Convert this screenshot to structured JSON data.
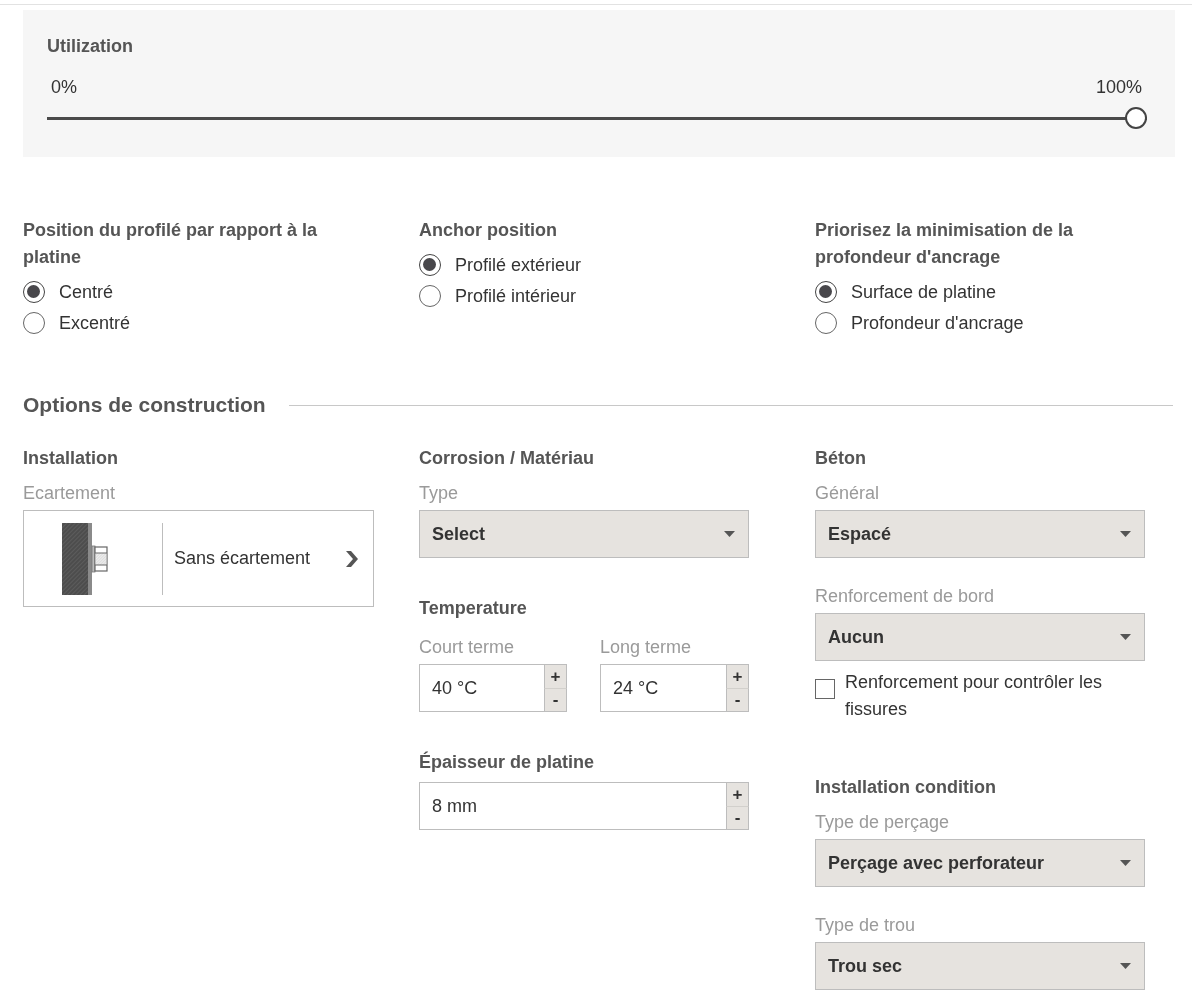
{
  "utilization": {
    "title": "Utilization",
    "min_label": "0%",
    "max_label": "100%",
    "level": 1
  },
  "radio_groups": [
    {
      "title": "Position du profilé par rapport à la platine",
      "options": [
        {
          "label": "Centré",
          "selected": true
        },
        {
          "label": "Excentré",
          "selected": false
        }
      ]
    },
    {
      "title": "Anchor position",
      "options": [
        {
          "label": "Profilé extérieur",
          "selected": true
        },
        {
          "label": "Profilé intérieur",
          "selected": false
        }
      ]
    },
    {
      "title": "Priorisez la minimisation de la profondeur d'ancrage",
      "options": [
        {
          "label": "Surface de platine",
          "selected": true
        },
        {
          "label": "Profondeur d'ancrage",
          "selected": false
        }
      ]
    }
  ],
  "construction": {
    "title": "Options de construction",
    "columns": [
      {
        "sections": [
          {
            "title": "Installation",
            "fields": [
              {
                "kind": "card",
                "label": "Ecartement",
                "value": "Sans écartement"
              }
            ]
          }
        ]
      },
      {
        "sections": [
          {
            "title": "Corrosion / Matériau",
            "fields": [
              {
                "kind": "select",
                "label": "Type",
                "value": "Select"
              }
            ]
          },
          {
            "title": "Temperature",
            "fields": [
              {
                "kind": "pair",
                "fields": [
                  {
                    "kind": "spinner",
                    "label": "Court terme",
                    "value": "40 °C",
                    "increment": "+",
                    "decrement": "-"
                  },
                  {
                    "kind": "spinner",
                    "label": "Long terme",
                    "value": "24 °C",
                    "increment": "+",
                    "decrement": "-"
                  }
                ]
              }
            ]
          },
          {
            "title": "Épaisseur de platine",
            "fields": [
              {
                "kind": "spinner",
                "value": "8 mm",
                "increment": "+",
                "decrement": "-"
              }
            ]
          }
        ]
      },
      {
        "sections": [
          {
            "title": "Béton",
            "fields": [
              {
                "kind": "select",
                "label": "Général",
                "value": "Espacé"
              },
              {
                "kind": "select",
                "label": "Renforcement de bord",
                "value": "Aucun"
              },
              {
                "kind": "checkbox",
                "label": "Renforcement pour contrôler les fissures",
                "checked": false
              }
            ]
          },
          {
            "title": "Installation condition",
            "fields": [
              {
                "kind": "select",
                "label": "Type de perçage",
                "value": "Perçage avec perforateur"
              },
              {
                "kind": "select",
                "label": "Type de trou",
                "value": "Trou sec"
              }
            ]
          }
        ]
      }
    ]
  }
}
